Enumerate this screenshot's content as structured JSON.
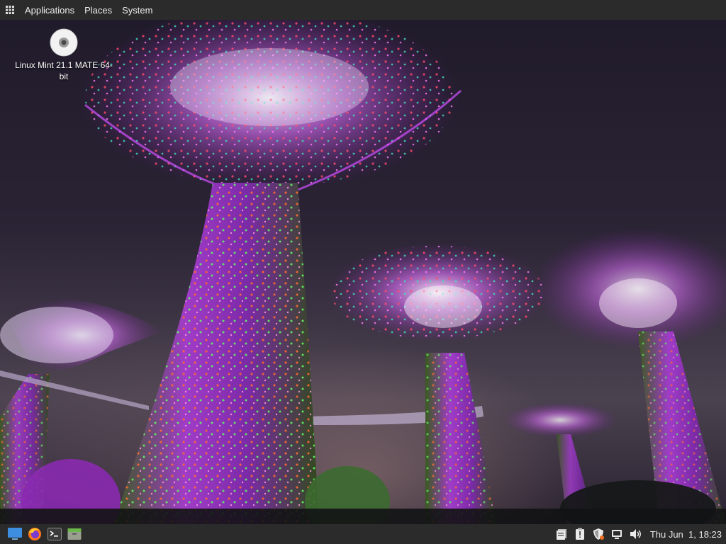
{
  "top_panel": {
    "menu": [
      {
        "label": "Applications"
      },
      {
        "label": "Places"
      },
      {
        "label": "System"
      }
    ],
    "menu_icon": "app-grid-icon"
  },
  "desktop": {
    "icons": [
      {
        "label": "Linux Mint 21.1 MATE 64-bit",
        "icon": "optical-disc-icon"
      }
    ],
    "wallpaper": "Supertree Grove at night, purple illuminated trees"
  },
  "bottom_panel": {
    "launchers": [
      {
        "icon": "show-desktop-icon"
      },
      {
        "icon": "firefox-icon"
      },
      {
        "icon": "terminal-icon"
      },
      {
        "icon": "file-manager-icon"
      }
    ],
    "tray": [
      {
        "icon": "clipboard-icon"
      },
      {
        "icon": "update-manager-icon"
      },
      {
        "icon": "shield-icon"
      },
      {
        "icon": "network-icon"
      },
      {
        "icon": "volume-icon"
      }
    ],
    "clock": "Thu Jun  1, 18:23"
  },
  "colors": {
    "panel": "#2b2b2b",
    "accent_purple": "#c040e0",
    "text": "#e8e8e8"
  }
}
